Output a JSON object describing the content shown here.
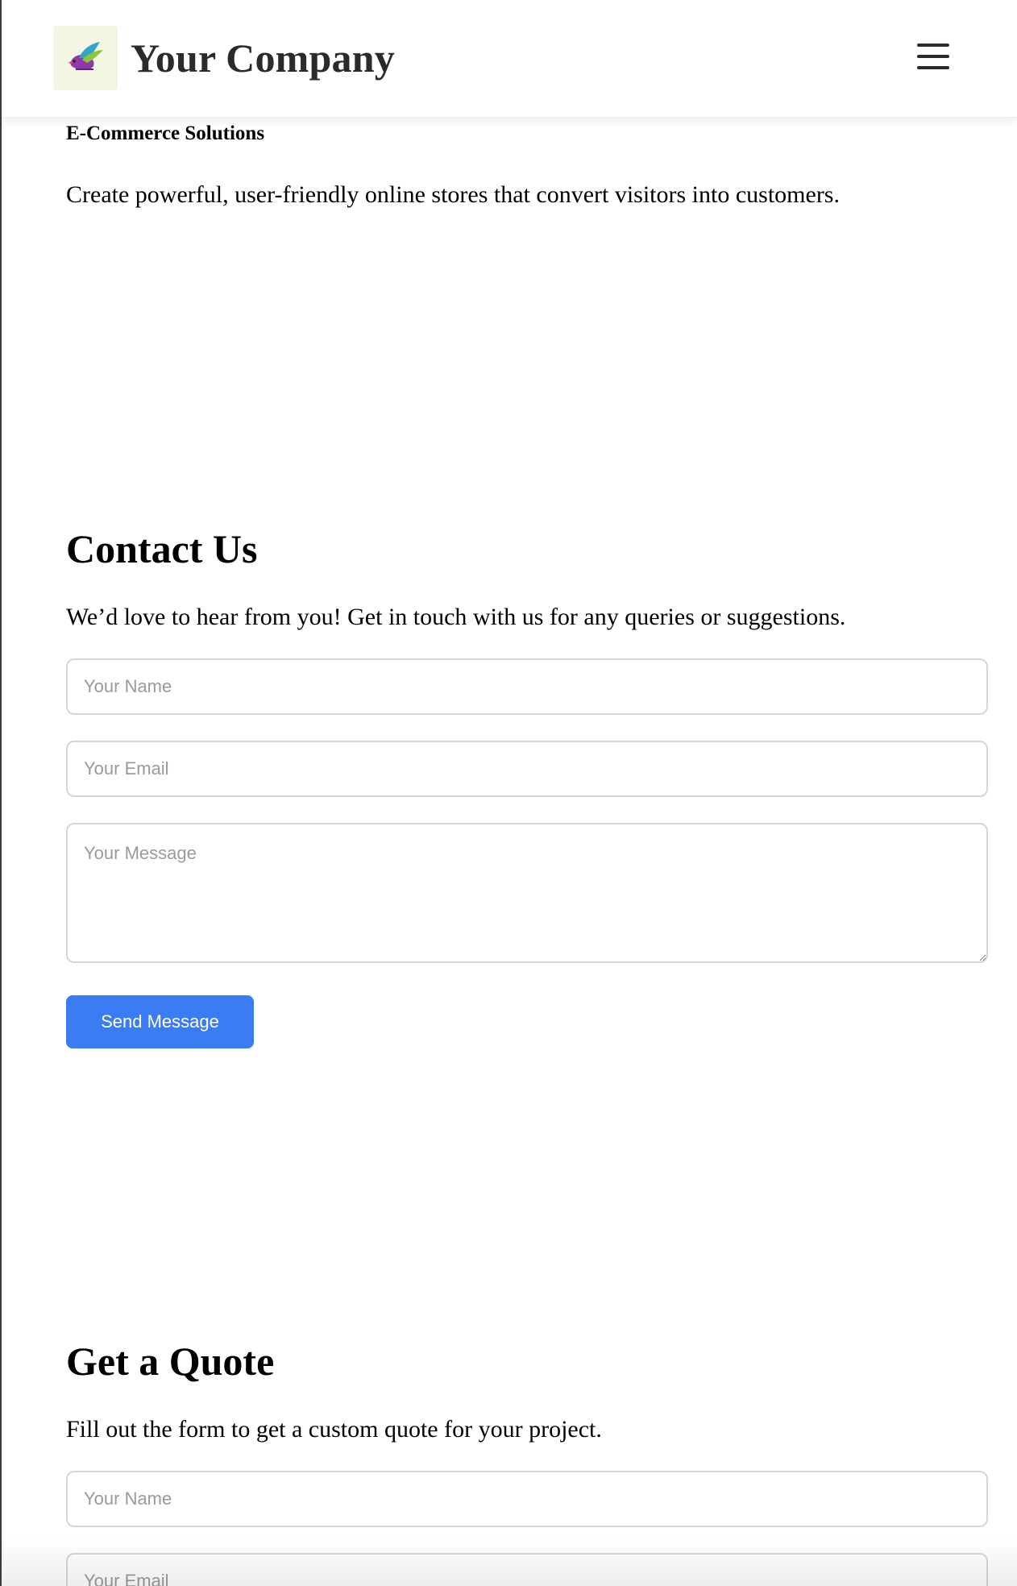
{
  "header": {
    "brand": "Your Company",
    "logo_icon": "bird-logo-icon",
    "menu_icon": "hamburger-menu-icon"
  },
  "service": {
    "title": "E-Commerce Solutions",
    "description": "Create powerful, user-friendly online stores that convert visitors into customers."
  },
  "contact": {
    "heading": "Contact Us",
    "intro": "We’d love to hear from you! Get in touch with us for any queries or suggestions.",
    "name_placeholder": "Your Name",
    "email_placeholder": "Your Email",
    "message_placeholder": "Your Message",
    "submit_label": "Send Message"
  },
  "quote": {
    "heading": "Get a Quote",
    "intro": "Fill out the form to get a custom quote for your project.",
    "name_placeholder": "Your Name",
    "email_placeholder": "Your Email"
  },
  "colors": {
    "primary_button": "#3b7cf2",
    "logo_background": "#f4f6e4",
    "text": "#000000"
  }
}
